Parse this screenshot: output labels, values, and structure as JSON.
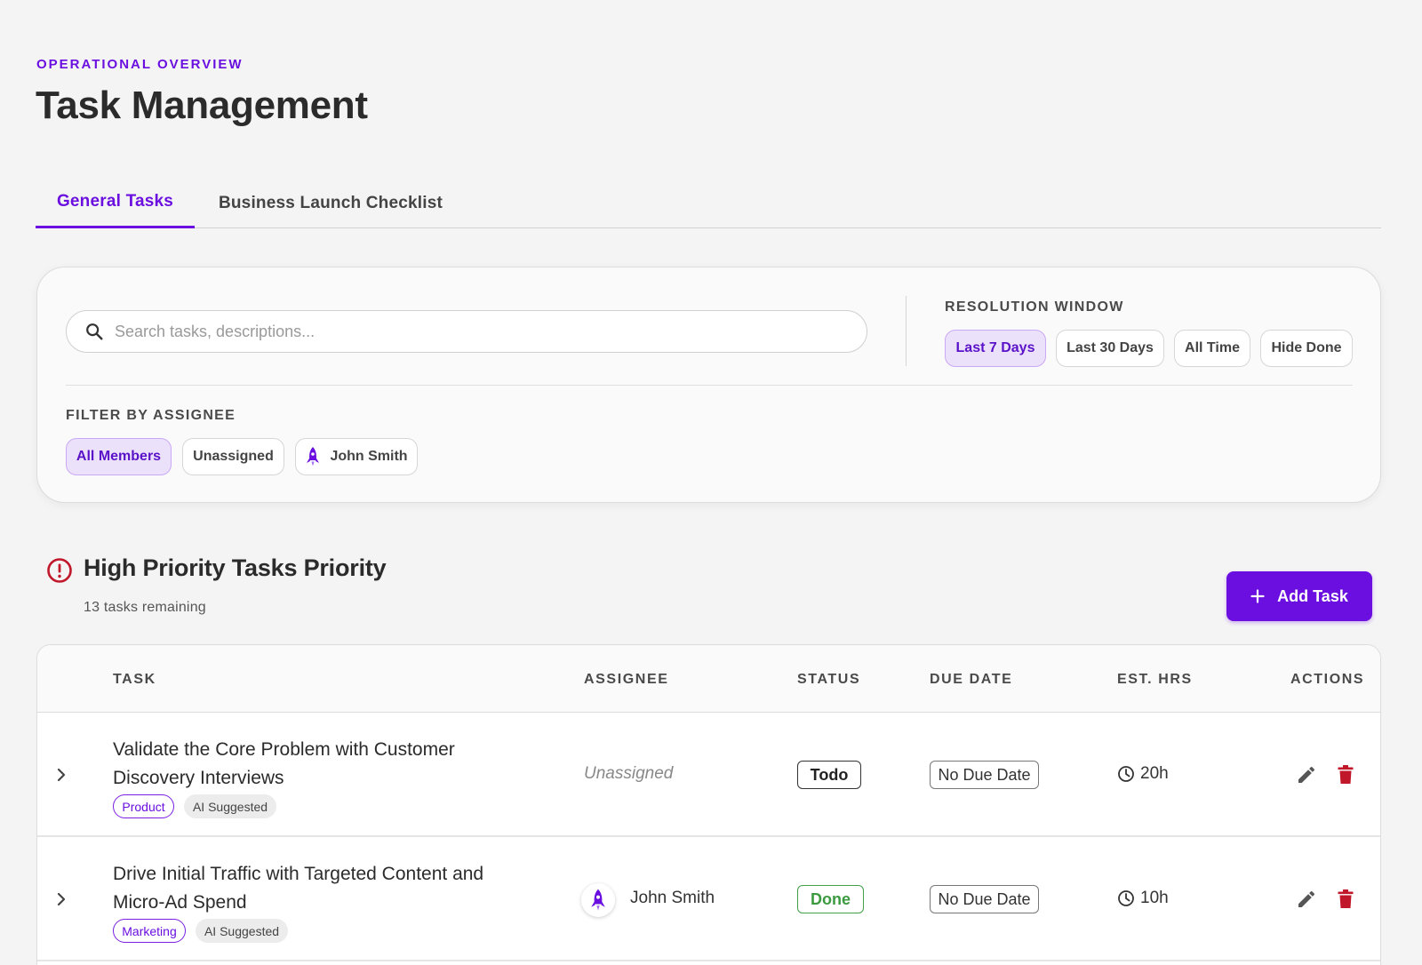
{
  "header": {
    "eyebrow": "OPERATIONAL OVERVIEW",
    "title": "Task Management"
  },
  "tabs": [
    {
      "label": "General Tasks",
      "active": true
    },
    {
      "label": "Business Launch Checklist",
      "active": false
    }
  ],
  "filters": {
    "search_placeholder": "Search tasks, descriptions...",
    "search_icon": "search-icon",
    "resolution_label": "RESOLUTION WINDOW",
    "resolution_options": [
      {
        "label": "Last 7 Days",
        "active": true
      },
      {
        "label": "Last 30 Days",
        "active": false
      },
      {
        "label": "All Time",
        "active": false
      },
      {
        "label": "Hide Done",
        "active": false
      }
    ],
    "assignee_label": "FILTER BY ASSIGNEE",
    "assignee_options": [
      {
        "label": "All Members",
        "active": true
      },
      {
        "label": "Unassigned",
        "active": false
      },
      {
        "label": "John Smith",
        "active": false,
        "icon": "rocket-icon"
      }
    ]
  },
  "section": {
    "title": "High Priority Tasks Priority",
    "subtitle": "13 tasks remaining",
    "icon": "alert-circle-icon",
    "add_button": "Add Task"
  },
  "table": {
    "headers": [
      "TASK",
      "ASSIGNEE",
      "STATUS",
      "DUE DATE",
      "EST. HRS",
      "ACTIONS"
    ],
    "rows": [
      {
        "title": "Validate the Core Problem with Customer Discovery Interviews",
        "tags": [
          "Product",
          "AI Suggested"
        ],
        "assignee": "Unassigned",
        "status": "Todo",
        "due": "No Due Date",
        "est": "20h"
      },
      {
        "title": "Drive Initial Traffic with Targeted Content and Micro-Ad Spend",
        "tags": [
          "Marketing",
          "AI Suggested"
        ],
        "assignee": "John Smith",
        "status": "Done",
        "due": "No Due Date",
        "est": "10h"
      }
    ]
  },
  "colors": {
    "accent": "#6a0fe0",
    "danger": "#c0172b",
    "done": "#43a047",
    "background": "#f4f4f4"
  }
}
